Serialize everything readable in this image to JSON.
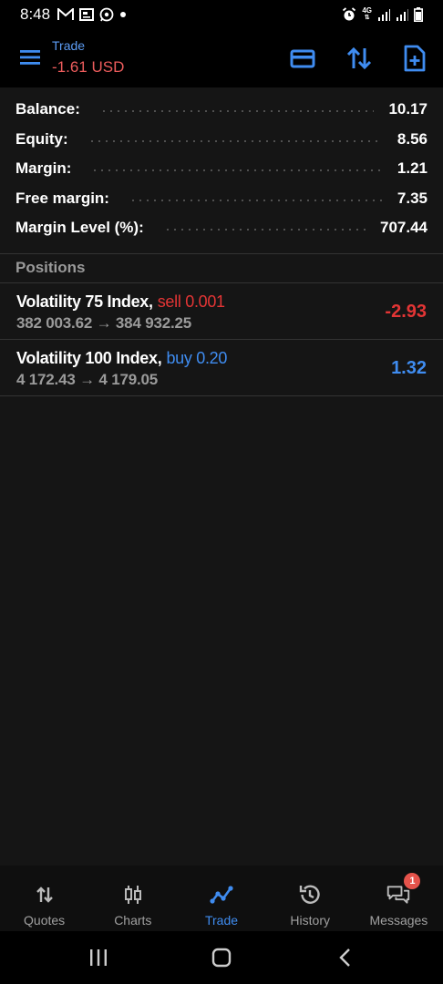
{
  "status_bar": {
    "time": "8:48",
    "network": "4G"
  },
  "header": {
    "title": "Trade",
    "profit": "-1.61 USD"
  },
  "summary": [
    {
      "label": "Balance:",
      "value": "10.17"
    },
    {
      "label": "Equity:",
      "value": "8.56"
    },
    {
      "label": "Margin:",
      "value": "1.21"
    },
    {
      "label": "Free margin:",
      "value": "7.35"
    },
    {
      "label": "Margin Level (%):",
      "value": "707.44"
    }
  ],
  "positions_title": "Positions",
  "positions": [
    {
      "symbol": "Volatility 75 Index,",
      "side": "sell 0.001",
      "prices": "382 003.62 → 384 932.25",
      "profit": "-2.93"
    },
    {
      "symbol": "Volatility 100 Index,",
      "side": "buy 0.20",
      "prices": "4 172.43 → 4 179.05",
      "profit": "1.32"
    }
  ],
  "tabs": [
    {
      "label": "Quotes",
      "icon": "quotes-icon"
    },
    {
      "label": "Charts",
      "icon": "charts-icon"
    },
    {
      "label": "Trade",
      "icon": "trade-icon",
      "active": true
    },
    {
      "label": "History",
      "icon": "history-icon"
    },
    {
      "label": "Messages",
      "icon": "messages-icon",
      "badge": "1"
    }
  ],
  "colors": {
    "accent": "#3f8cf0",
    "loss": "#e33535",
    "header_loss": "#ec5c5c"
  }
}
